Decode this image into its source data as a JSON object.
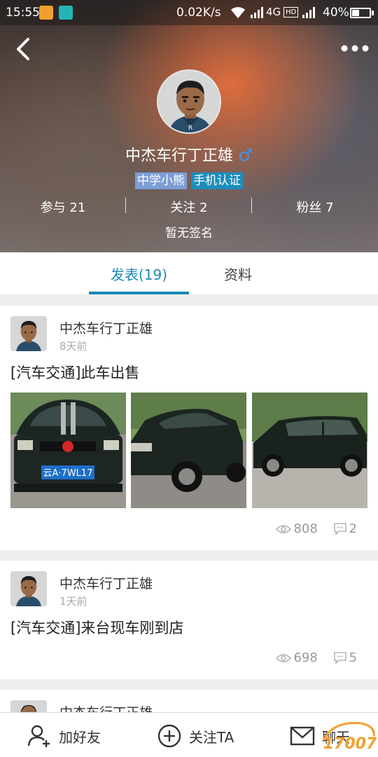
{
  "status_bar": {
    "time": "15:55",
    "net_speed": "0.02K/s",
    "network_type": "4G",
    "hd_label": "HD",
    "battery": "40%",
    "battery_level": 0.4
  },
  "profile": {
    "name": "中杰车行丁正雄",
    "gender": "male",
    "badges": [
      "中学小熊",
      "手机认证"
    ],
    "stats": {
      "participate": "参与 21",
      "following": "关注 2",
      "fans": "粉丝 7"
    },
    "signature": "暂无签名"
  },
  "tabs": [
    {
      "label": "发表(19)",
      "active": true
    },
    {
      "label": "资料",
      "active": false
    }
  ],
  "posts": [
    {
      "author": "中杰车行丁正雄",
      "time": "8天前",
      "title": "[汽车交通]此车出售",
      "plate": "云A·7WL17",
      "views": "808",
      "comments": "2"
    },
    {
      "author": "中杰车行丁正雄",
      "time": "1天前",
      "title": "[汽车交通]来台现车刚到店",
      "views": "698",
      "comments": "5"
    },
    {
      "author": "中杰车行丁正雄"
    }
  ],
  "bottom_bar": {
    "add_friend": "加好友",
    "follow": "关注TA",
    "chat": "聊天"
  },
  "watermark": "17007",
  "colors": {
    "accent": "#1a8ab6",
    "badge_primary": "#7c9ed6",
    "badge_secondary": "#1c8dbb",
    "gender": "#4a8fe0"
  },
  "icons": [
    "back-arrow",
    "more-dots",
    "male",
    "eye",
    "comment",
    "person-add",
    "plus-circle",
    "envelope"
  ]
}
